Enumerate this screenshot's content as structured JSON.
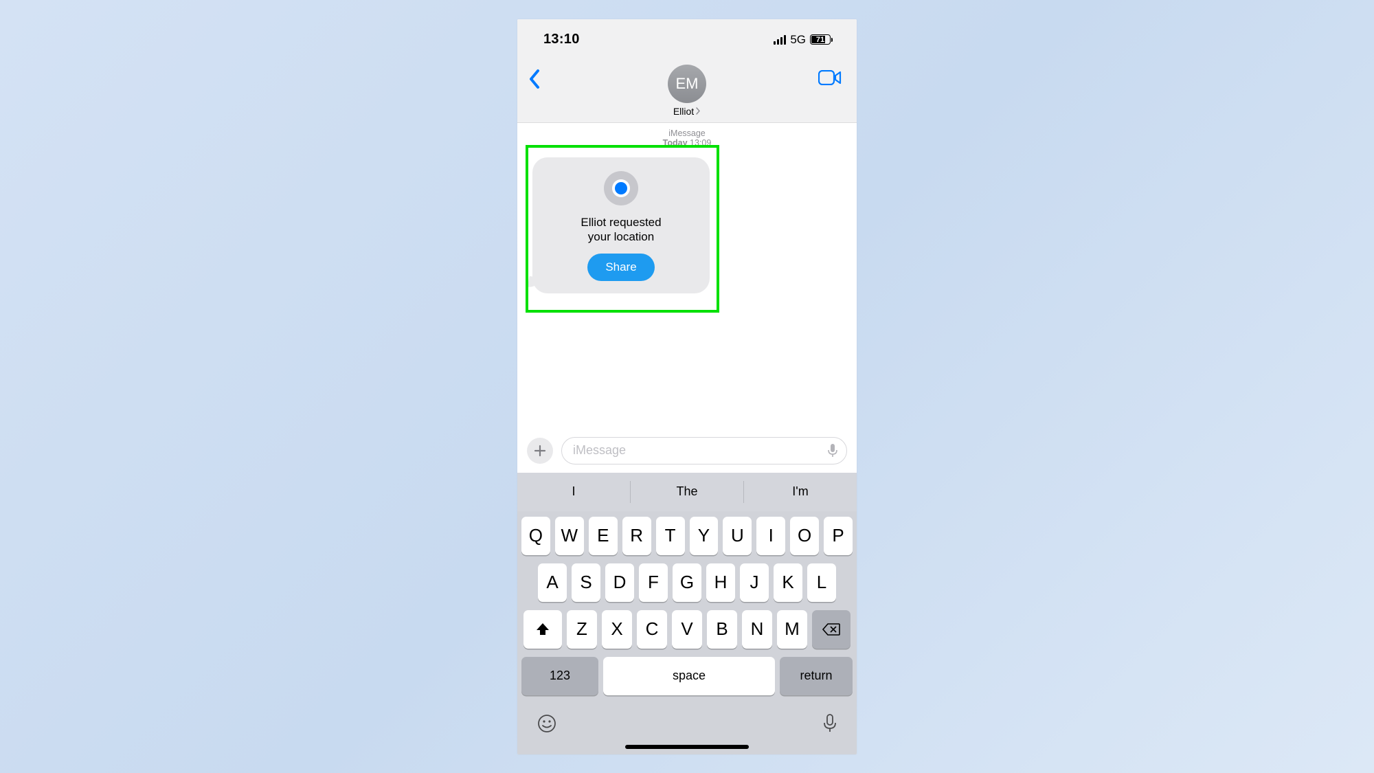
{
  "status": {
    "time": "13:10",
    "network": "5G",
    "battery_pct": "71"
  },
  "header": {
    "avatar_initials": "EM",
    "contact_name": "Elliot"
  },
  "chat": {
    "service": "iMessage",
    "timestamp_prefix": "Today",
    "timestamp_time": "13:09",
    "bubble_line1": "Elliot requested",
    "bubble_line2": "your location",
    "share_label": "Share"
  },
  "compose": {
    "placeholder": "iMessage"
  },
  "keyboard": {
    "suggestions": [
      "I",
      "The",
      "I'm"
    ],
    "row1": [
      "Q",
      "W",
      "E",
      "R",
      "T",
      "Y",
      "U",
      "I",
      "O",
      "P"
    ],
    "row2": [
      "A",
      "S",
      "D",
      "F",
      "G",
      "H",
      "J",
      "K",
      "L"
    ],
    "row3": [
      "Z",
      "X",
      "C",
      "V",
      "B",
      "N",
      "M"
    ],
    "numkey": "123",
    "space": "space",
    "return": "return"
  },
  "colors": {
    "ios_blue": "#007aff",
    "highlight": "#00e000"
  }
}
